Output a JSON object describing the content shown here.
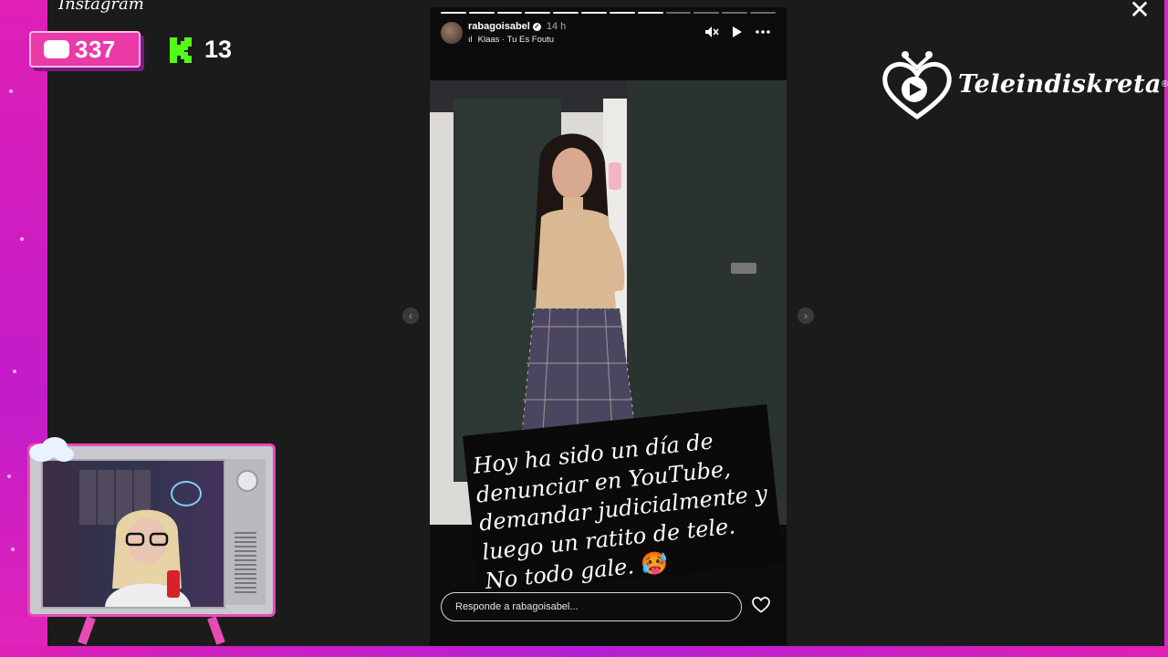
{
  "app": {
    "logo_text": "Instagram",
    "close_label": "✕"
  },
  "overlay": {
    "chat_count": "337",
    "kick_count": "13",
    "brand_name": "Teleindiskreta",
    "brand_reg": "®"
  },
  "story": {
    "username": "rabagoisabel",
    "time_ago": "14 h",
    "music": "Klaas · Tu Es Foutu",
    "progress": {
      "total": 12,
      "completed": 8
    },
    "caption": "Hoy ha sido un día de denunciar en YouTube, demandar judicialmente y luego un ratito de tele. No todo gale.",
    "caption_emoji": "🥵",
    "reply_placeholder": "Responde a rabagoisabel..."
  },
  "icons": {
    "mute": "muted-speaker-icon",
    "play": "play-icon",
    "more": "more-options-icon",
    "like": "heart-icon",
    "prev": "chevron-left-icon",
    "next": "chevron-right-icon"
  },
  "colors": {
    "frame": "#e01fb6",
    "chat_badge": "#ea3aa8",
    "kick_green": "#53fc18",
    "background": "#1b1b1b"
  }
}
